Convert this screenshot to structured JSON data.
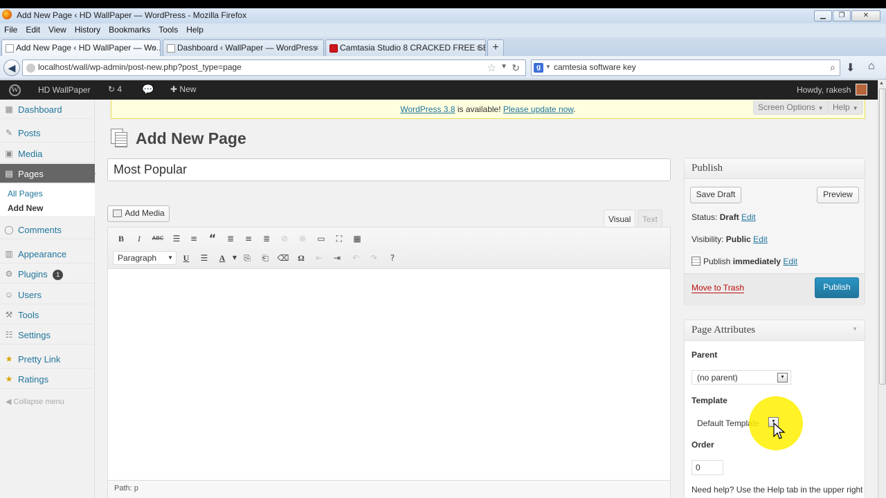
{
  "browser": {
    "window_title": "Add New Page ‹ HD WallPaper — WordPress - Mozilla Firefox",
    "menu": [
      "File",
      "Edit",
      "View",
      "History",
      "Bookmarks",
      "Tools",
      "Help"
    ],
    "tabs": [
      {
        "label": "Add New Page ‹ HD WallPaper — Wo...",
        "close": "×"
      },
      {
        "label": "Dashboard ‹ WallPaper — WordPress",
        "close": "×"
      },
      {
        "label": "Camtasia Studio 8 CRACKED FREE SE...",
        "close": "×"
      }
    ],
    "new_tab": "+",
    "url": "localhost/wall/wp-admin/post-new.php?post_type=page",
    "search_engine_letter": "g",
    "search_value": "camtesia software key"
  },
  "adminbar": {
    "site_name": "HD WallPaper",
    "updates_count": "4",
    "new_label": "New",
    "howdy": "Howdy, rakesh"
  },
  "sidebar": {
    "dashboard": "Dashboard",
    "posts": "Posts",
    "media": "Media",
    "pages": "Pages",
    "all_pages": "All Pages",
    "add_new": "Add New",
    "comments": "Comments",
    "appearance": "Appearance",
    "plugins": "Plugins",
    "plugins_badge": "1",
    "users": "Users",
    "tools": "Tools",
    "settings": "Settings",
    "pretty_link": "Pretty Link",
    "ratings": "Ratings",
    "collapse": "Collapse menu"
  },
  "notice": {
    "version_link": "WordPress 3.8",
    "middle": " is available! ",
    "update_link": "Please update now",
    "end": "."
  },
  "screen_options": "Screen Options",
  "help": "Help",
  "page_heading": "Add New Page",
  "post_title": "Most Popular",
  "editor": {
    "add_media": "Add Media",
    "tab_visual": "Visual",
    "tab_text": "Text",
    "format": "Paragraph",
    "path": "Path: p"
  },
  "publish": {
    "title": "Publish",
    "save_draft": "Save Draft",
    "preview": "Preview",
    "status_label": "Status: ",
    "status_value": "Draft",
    "visibility_label": "Visibility: ",
    "visibility_value": "Public",
    "publish_label": "Publish ",
    "publish_value": "immediately",
    "edit": "Edit",
    "move_to_trash": "Move to Trash",
    "publish_button": "Publish"
  },
  "attributes": {
    "title": "Page Attributes",
    "parent_label": "Parent",
    "parent_value": "(no parent)",
    "template_label": "Template",
    "template_value": "Default Template",
    "order_label": "Order",
    "order_value": "0",
    "help_text": "Need help? Use the Help tab in the upper right"
  }
}
